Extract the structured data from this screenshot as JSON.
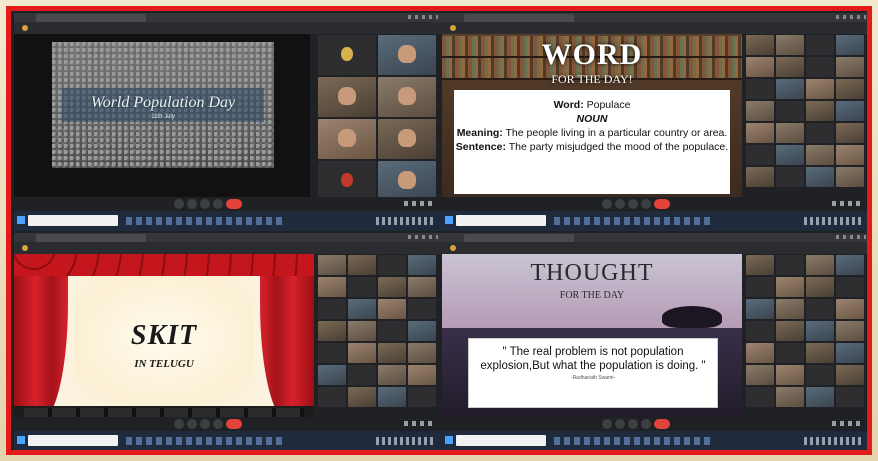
{
  "panel1": {
    "slide_title": "World Population Day",
    "slide_date": "11th July"
  },
  "panel2": {
    "heading": "WORD",
    "subheading": "FOR THE DAY!",
    "word_label": "Word:",
    "word": "Populace",
    "part_of_speech": "NOUN",
    "meaning_label": "Meaning:",
    "meaning": "The people living in a particular country or area.",
    "sentence_label": "Sentence:",
    "sentence": "The party misjudged the mood of the populace."
  },
  "panel3": {
    "title": "SKIT",
    "subtitle": "IN TELUGU"
  },
  "panel4": {
    "heading": "THOUGHT",
    "subheading": "FOR THE DAY",
    "quote": "\" The real problem is not population explosion,But what the population is doing. \"",
    "author": "-Radhanath Swami-"
  },
  "colors": {
    "frame_border": "#e31b1b",
    "end_call": "#e2433a",
    "meet_bg": "#202124"
  },
  "icons": [
    "mic-icon",
    "camera-icon",
    "present-icon",
    "more-icon",
    "end-call-icon",
    "windows-start-icon"
  ]
}
